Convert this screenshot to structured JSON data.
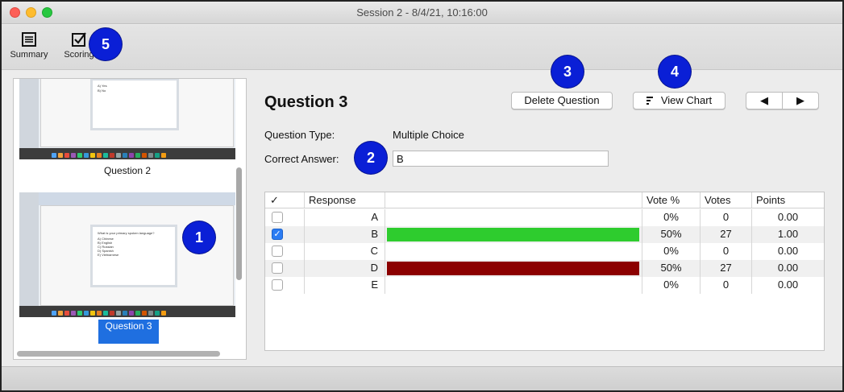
{
  "window": {
    "title": "Session 2 - 8/4/21, 10:16:00"
  },
  "toolbar": {
    "summary_label": "Summary",
    "scoring_label": "Scoring",
    "summary_icon": "list-icon",
    "scoring_icon": "checkbox-icon"
  },
  "badges": [
    "1",
    "2",
    "3",
    "4",
    "5"
  ],
  "thumbnails": [
    {
      "label": "Question 2",
      "lines": [
        "A)  Yes",
        "B)  No"
      ]
    },
    {
      "label": "Question 3",
      "selected": true,
      "lines": [
        "What is your primary spoken language?",
        "A)  Chinese",
        "B)  English",
        "C)  Russian",
        "D)  Spanish",
        "E)  Vietnamese"
      ]
    }
  ],
  "question": {
    "title": "Question 3",
    "type_label": "Question Type:",
    "type_value": "Multiple Choice",
    "answer_label": "Correct Answer:",
    "answer_value": "B"
  },
  "buttons": {
    "delete": "Delete Question",
    "view_chart": "View Chart",
    "prev_icon": "◀",
    "next_icon": "▶"
  },
  "table": {
    "headers": {
      "check": "✓",
      "response": "Response",
      "vote_pct": "Vote %",
      "votes": "Votes",
      "points": "Points"
    },
    "rows": [
      {
        "response": "A",
        "checked": false,
        "vote_pct": "0%",
        "votes": "0",
        "points": "0.00",
        "bar_fraction": 0.0,
        "bar_color": ""
      },
      {
        "response": "B",
        "checked": true,
        "vote_pct": "50%",
        "votes": "27",
        "points": "1.00",
        "bar_fraction": 1.0,
        "bar_color": "#2ecc2e"
      },
      {
        "response": "C",
        "checked": false,
        "vote_pct": "0%",
        "votes": "0",
        "points": "0.00",
        "bar_fraction": 0.0,
        "bar_color": ""
      },
      {
        "response": "D",
        "checked": false,
        "vote_pct": "50%",
        "votes": "27",
        "points": "0.00",
        "bar_fraction": 1.0,
        "bar_color": "#8b0000"
      },
      {
        "response": "E",
        "checked": false,
        "vote_pct": "0%",
        "votes": "0",
        "points": "0.00",
        "bar_fraction": 0.0,
        "bar_color": ""
      }
    ]
  }
}
